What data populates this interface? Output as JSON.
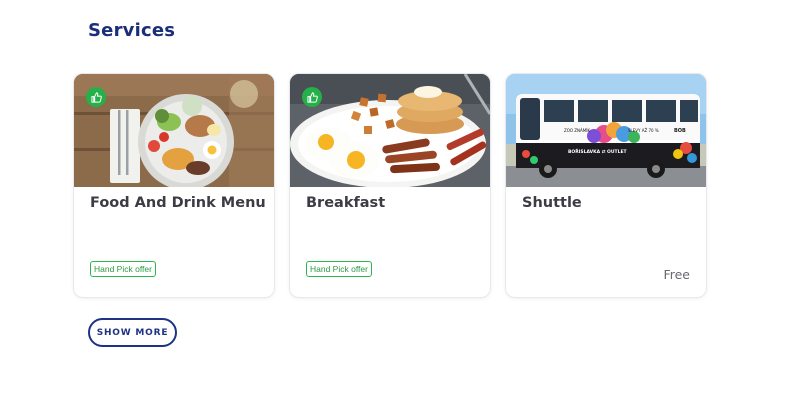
{
  "section": {
    "title": "Services"
  },
  "cards": [
    {
      "title": "Food And Drink Menu",
      "tag": "Hand Pick offer",
      "image": "salad-plate-photo",
      "recommended": true
    },
    {
      "title": "Breakfast",
      "tag": "Hand Pick offer",
      "image": "breakfast-plate-photo",
      "recommended": true
    },
    {
      "title": "Shuttle",
      "price": "Free",
      "image": "shuttle-bus-photo",
      "recommended": false
    }
  ],
  "bus_livery": {
    "line1": "ZOO ZNÁMÍK",
    "line2": "SLEVY AŽ 70 %",
    "line3": "BOŘISLAVKA ⇄ OUTLET",
    "brand": "BOB"
  },
  "actions": {
    "show_more": "SHOW MORE"
  },
  "colors": {
    "title": "#1b2e7a",
    "accent_green": "#25b04a",
    "button_border": "#1e3385"
  }
}
